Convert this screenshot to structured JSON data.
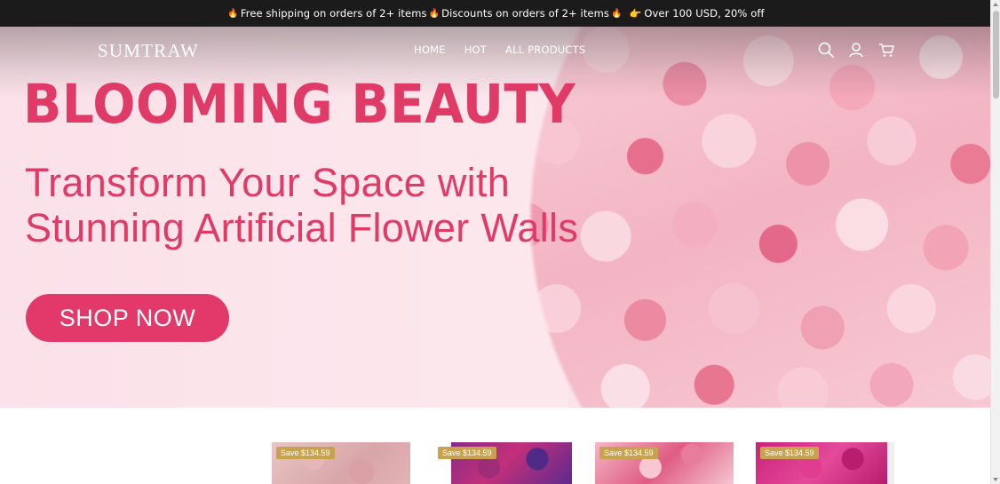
{
  "announcement": {
    "part1": "Free shipping on orders of 2+ items",
    "part2": "Discounts on orders of 2+ items",
    "part3": "Over 100 USD, 20% off",
    "flame_glyph": "🔥",
    "hand_glyph": "👉"
  },
  "header": {
    "logo": "SUMTRAW",
    "nav": [
      "HOME",
      "HOT",
      "ALL PRODUCTS"
    ],
    "icons": [
      "search-icon",
      "account-icon",
      "cart-icon"
    ]
  },
  "hero": {
    "headline": "BLOOMING BEAUTY",
    "sub_line1": "Transform Your Space with",
    "sub_line2": "Stunning Artificial Flower Walls",
    "cta": "SHOP NOW"
  },
  "products": [
    {
      "badge": "Save $134.59"
    },
    {
      "badge": "Save $134.59"
    },
    {
      "badge": "Save $134.59"
    },
    {
      "badge": "Save $134.59"
    }
  ],
  "colors": {
    "accent": "#e03a66",
    "announcement_bg": "#1b1b1b",
    "badge": "#c9a24d"
  }
}
